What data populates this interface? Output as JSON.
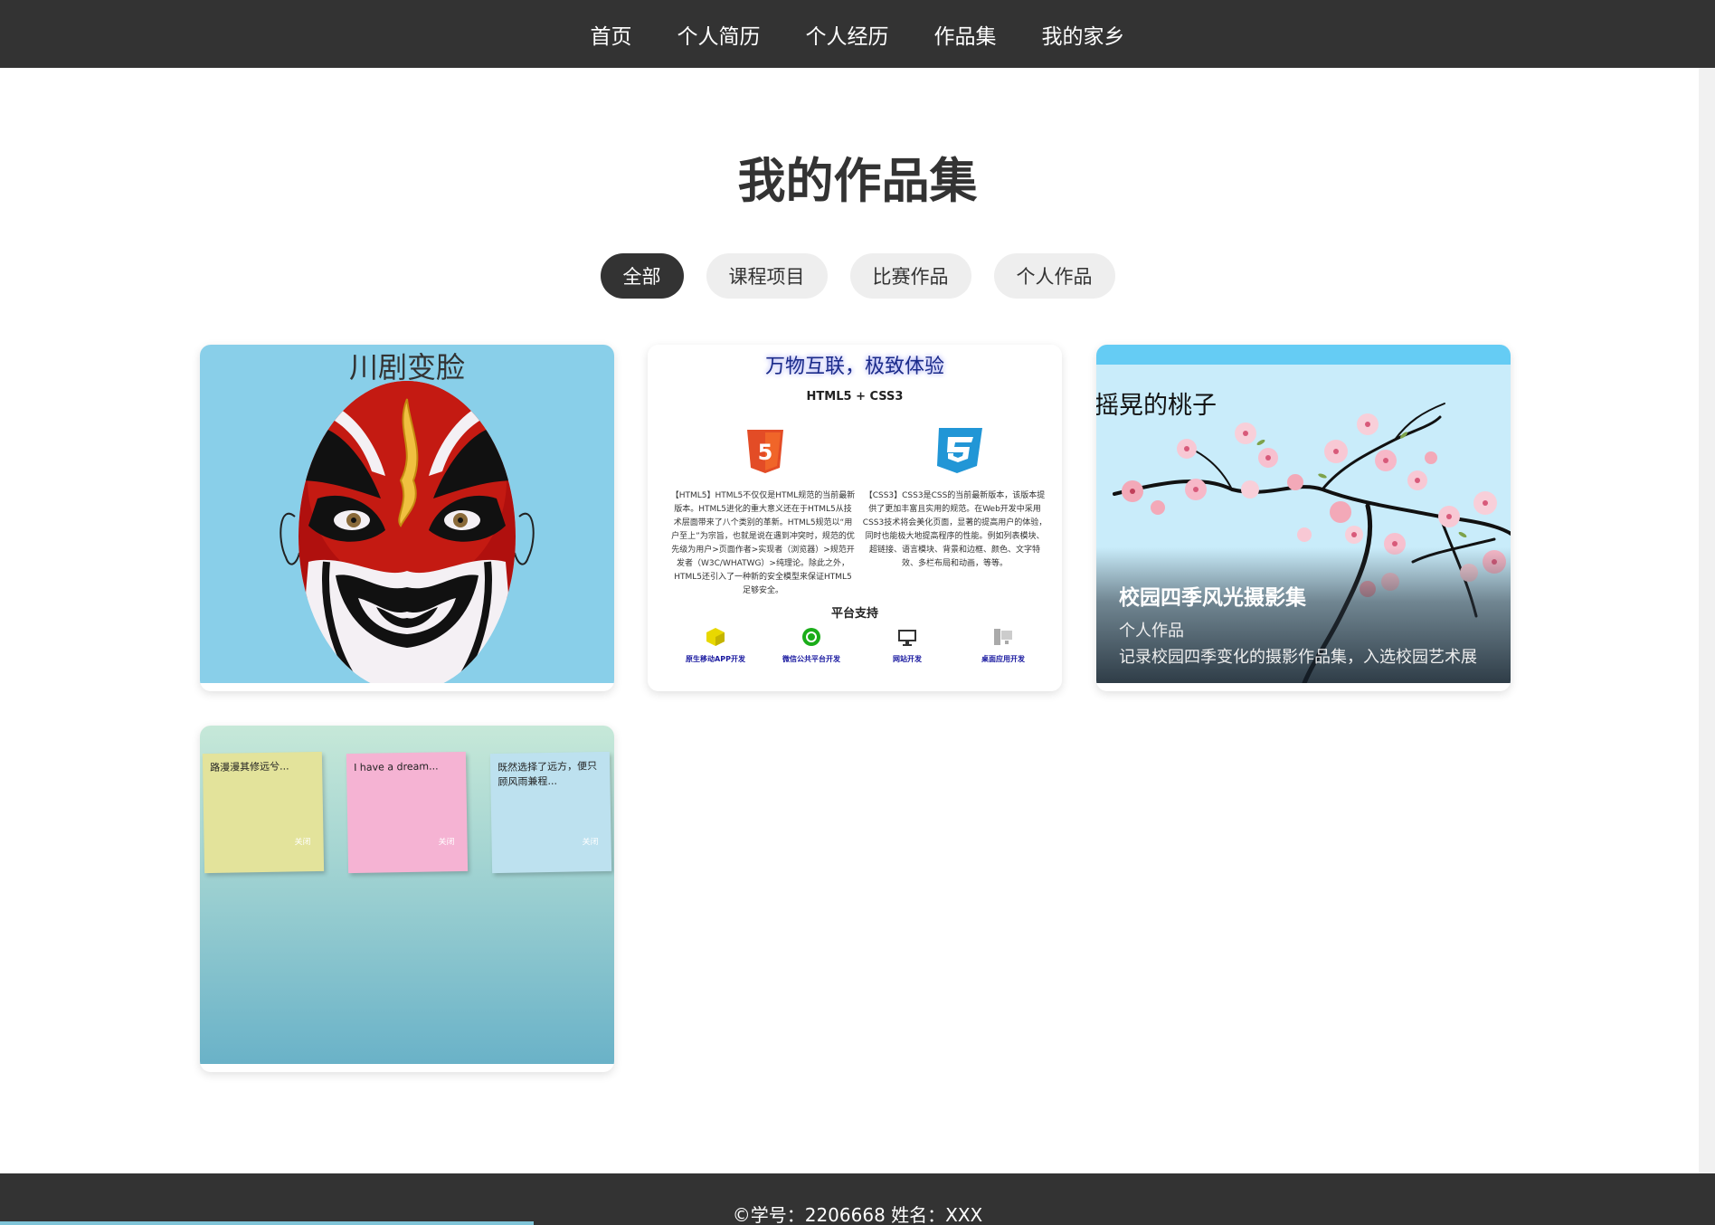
{
  "nav": {
    "items": [
      "首页",
      "个人简历",
      "个人经历",
      "作品集",
      "我的家乡"
    ]
  },
  "main": {
    "title": "我的作品集",
    "filters": [
      {
        "label": "全部",
        "active": true
      },
      {
        "label": "课程项目",
        "active": false
      },
      {
        "label": "比赛作品",
        "active": false
      },
      {
        "label": "个人作品",
        "active": false
      }
    ]
  },
  "cards": {
    "opera": {
      "title": "川剧变脸"
    },
    "html": {
      "title": "万物互联，极致体验",
      "subtitle": "HTML5 + CSS3",
      "html_text": "【HTML5】HTML5不仅仅是HTML规范的当前最新版本。HTML5进化的重大意义还在于HTML5从技术层面带来了八个类别的革新。HTML5规范以“用户至上”为宗旨，也就是说在遇到冲突时，规范的优先级为用户>页面作者>实现者（浏览器）>规范开发者（W3C/WHATWG）>纯理论。除此之外，HTML5还引入了一种新的安全模型来保证HTML5足够安全。",
      "css_text": "【CSS3】CSS3是CSS的当前最新版本，该版本提供了更加丰富且实用的规范。在Web开发中采用CSS3技术将会美化页面，显著的提高用户的体验，同时也能极大地提高程序的性能。例如列表模块、超链接、语言模块、背景和边框、颜色、文字特效、多栏布局和动画，等等。",
      "platform_title": "平台支持",
      "platforms": [
        "原生移动APP开发",
        "微信公共平台开发",
        "网站开发",
        "桌面应用开发"
      ]
    },
    "peach": {
      "image_title": "摇晃的桃子",
      "title": "校园四季风光摄影集",
      "category": "个人作品",
      "description": "记录校园四季变化的摄影作品集，入选校园艺术展"
    },
    "notes": {
      "items": [
        {
          "text": "路漫漫其修远兮...",
          "close": "关闭",
          "color": "#e3e39b"
        },
        {
          "text": "I have a dream...",
          "close": "关闭",
          "color": "#f5b3d3"
        },
        {
          "text": "既然选择了远方，便只顾风雨兼程...",
          "close": "关闭",
          "color": "#bde1ef"
        }
      ]
    }
  },
  "footer": {
    "text": "©学号：2206668 姓名：XXX"
  },
  "colors": {
    "nav_bg": "#333333",
    "card1_bg": "#89cfe9",
    "card3_band": "#65ccf4"
  }
}
